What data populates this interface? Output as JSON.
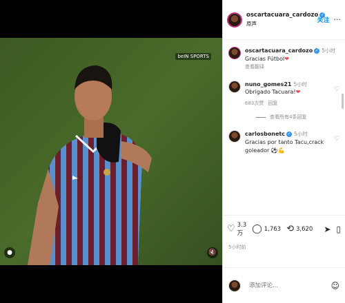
{
  "video": {
    "channel_badge": "beIN SPORTS"
  },
  "post": {
    "username": "oscartacuara_cardozo",
    "subtitle": "原声",
    "follow_label": "关注",
    "more_label": "···"
  },
  "comments": [
    {
      "username": "oscartacuara_cardozo",
      "time": "5小时",
      "text": "Gracias Fútbol",
      "emoji": "❤",
      "translate": "查看翻译"
    },
    {
      "username": "nuno_gomes21",
      "time": "5小时",
      "text": "Obrigado Tacuara!",
      "emoji": "❤",
      "likes": "683次赞",
      "reply": "回复",
      "view_replies": "查看所有4条回复"
    },
    {
      "username": "carlosbonetc",
      "time": "5小时",
      "text": "Gracias por tanto Tacu,crack goleador",
      "emoji": "⚽💪"
    }
  ],
  "actions": {
    "likes": "3.3 万",
    "comments": "1,763",
    "shares": "3,620"
  },
  "post_time": "5小时前",
  "add_comment": {
    "placeholder": "添加评论..."
  },
  "colors": {
    "follow": "#0095f6",
    "verified": "#3897f0",
    "heart": "#ed4956"
  }
}
